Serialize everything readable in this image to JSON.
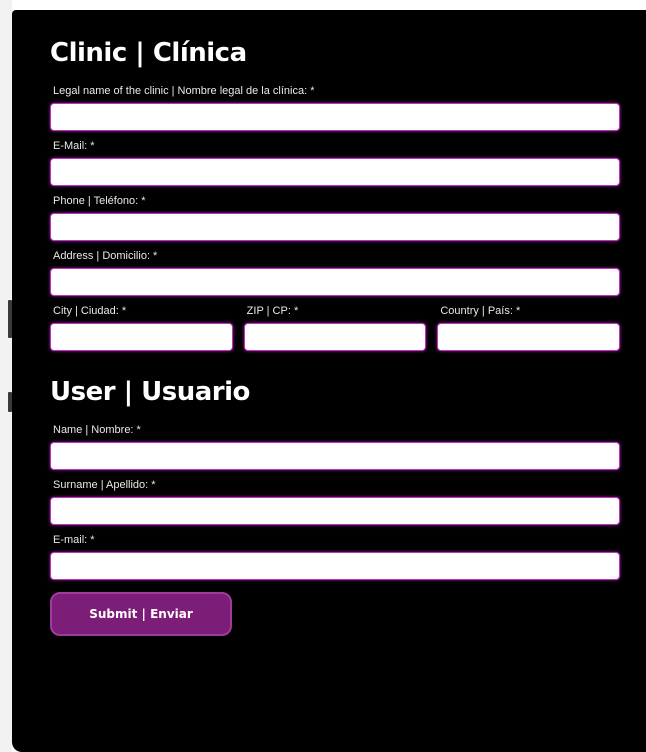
{
  "clinic": {
    "title": "Clinic | Clínica",
    "fields": {
      "legal_name": {
        "label": "Legal name of the clinic | Nombre legal de la clínica: *",
        "value": ""
      },
      "email": {
        "label": "E-Mail: *",
        "value": ""
      },
      "phone": {
        "label": "Phone | Teléfono: *",
        "value": ""
      },
      "address": {
        "label": "Address | Domicilio: *",
        "value": ""
      },
      "city": {
        "label": "City | Ciudad: *",
        "value": ""
      },
      "zip": {
        "label": "ZIP | CP: *",
        "value": ""
      },
      "country": {
        "label": "Country | País: *",
        "value": ""
      }
    }
  },
  "user": {
    "title": "User | Usuario",
    "fields": {
      "name": {
        "label": "Name | Nombre: *",
        "value": ""
      },
      "surname": {
        "label": "Surname | Apellido: *",
        "value": ""
      },
      "email": {
        "label": "E-mail: *",
        "value": ""
      }
    }
  },
  "submit": {
    "label": "Submit | Enviar"
  },
  "colors": {
    "panel": "#000000",
    "accent": "#c22fc7",
    "button": "#7c1d78"
  }
}
